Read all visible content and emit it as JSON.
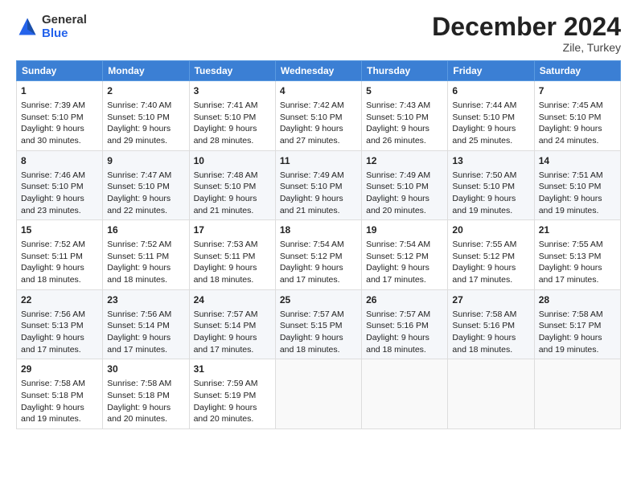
{
  "header": {
    "logo_line1": "General",
    "logo_line2": "Blue",
    "month_year": "December 2024",
    "location": "Zile, Turkey"
  },
  "weekdays": [
    "Sunday",
    "Monday",
    "Tuesday",
    "Wednesday",
    "Thursday",
    "Friday",
    "Saturday"
  ],
  "weeks": [
    [
      {
        "day": "1",
        "lines": [
          "Sunrise: 7:39 AM",
          "Sunset: 5:10 PM",
          "Daylight: 9 hours",
          "and 30 minutes."
        ]
      },
      {
        "day": "2",
        "lines": [
          "Sunrise: 7:40 AM",
          "Sunset: 5:10 PM",
          "Daylight: 9 hours",
          "and 29 minutes."
        ]
      },
      {
        "day": "3",
        "lines": [
          "Sunrise: 7:41 AM",
          "Sunset: 5:10 PM",
          "Daylight: 9 hours",
          "and 28 minutes."
        ]
      },
      {
        "day": "4",
        "lines": [
          "Sunrise: 7:42 AM",
          "Sunset: 5:10 PM",
          "Daylight: 9 hours",
          "and 27 minutes."
        ]
      },
      {
        "day": "5",
        "lines": [
          "Sunrise: 7:43 AM",
          "Sunset: 5:10 PM",
          "Daylight: 9 hours",
          "and 26 minutes."
        ]
      },
      {
        "day": "6",
        "lines": [
          "Sunrise: 7:44 AM",
          "Sunset: 5:10 PM",
          "Daylight: 9 hours",
          "and 25 minutes."
        ]
      },
      {
        "day": "7",
        "lines": [
          "Sunrise: 7:45 AM",
          "Sunset: 5:10 PM",
          "Daylight: 9 hours",
          "and 24 minutes."
        ]
      }
    ],
    [
      {
        "day": "8",
        "lines": [
          "Sunrise: 7:46 AM",
          "Sunset: 5:10 PM",
          "Daylight: 9 hours",
          "and 23 minutes."
        ]
      },
      {
        "day": "9",
        "lines": [
          "Sunrise: 7:47 AM",
          "Sunset: 5:10 PM",
          "Daylight: 9 hours",
          "and 22 minutes."
        ]
      },
      {
        "day": "10",
        "lines": [
          "Sunrise: 7:48 AM",
          "Sunset: 5:10 PM",
          "Daylight: 9 hours",
          "and 21 minutes."
        ]
      },
      {
        "day": "11",
        "lines": [
          "Sunrise: 7:49 AM",
          "Sunset: 5:10 PM",
          "Daylight: 9 hours",
          "and 21 minutes."
        ]
      },
      {
        "day": "12",
        "lines": [
          "Sunrise: 7:49 AM",
          "Sunset: 5:10 PM",
          "Daylight: 9 hours",
          "and 20 minutes."
        ]
      },
      {
        "day": "13",
        "lines": [
          "Sunrise: 7:50 AM",
          "Sunset: 5:10 PM",
          "Daylight: 9 hours",
          "and 19 minutes."
        ]
      },
      {
        "day": "14",
        "lines": [
          "Sunrise: 7:51 AM",
          "Sunset: 5:10 PM",
          "Daylight: 9 hours",
          "and 19 minutes."
        ]
      }
    ],
    [
      {
        "day": "15",
        "lines": [
          "Sunrise: 7:52 AM",
          "Sunset: 5:11 PM",
          "Daylight: 9 hours",
          "and 18 minutes."
        ]
      },
      {
        "day": "16",
        "lines": [
          "Sunrise: 7:52 AM",
          "Sunset: 5:11 PM",
          "Daylight: 9 hours",
          "and 18 minutes."
        ]
      },
      {
        "day": "17",
        "lines": [
          "Sunrise: 7:53 AM",
          "Sunset: 5:11 PM",
          "Daylight: 9 hours",
          "and 18 minutes."
        ]
      },
      {
        "day": "18",
        "lines": [
          "Sunrise: 7:54 AM",
          "Sunset: 5:12 PM",
          "Daylight: 9 hours",
          "and 17 minutes."
        ]
      },
      {
        "day": "19",
        "lines": [
          "Sunrise: 7:54 AM",
          "Sunset: 5:12 PM",
          "Daylight: 9 hours",
          "and 17 minutes."
        ]
      },
      {
        "day": "20",
        "lines": [
          "Sunrise: 7:55 AM",
          "Sunset: 5:12 PM",
          "Daylight: 9 hours",
          "and 17 minutes."
        ]
      },
      {
        "day": "21",
        "lines": [
          "Sunrise: 7:55 AM",
          "Sunset: 5:13 PM",
          "Daylight: 9 hours",
          "and 17 minutes."
        ]
      }
    ],
    [
      {
        "day": "22",
        "lines": [
          "Sunrise: 7:56 AM",
          "Sunset: 5:13 PM",
          "Daylight: 9 hours",
          "and 17 minutes."
        ]
      },
      {
        "day": "23",
        "lines": [
          "Sunrise: 7:56 AM",
          "Sunset: 5:14 PM",
          "Daylight: 9 hours",
          "and 17 minutes."
        ]
      },
      {
        "day": "24",
        "lines": [
          "Sunrise: 7:57 AM",
          "Sunset: 5:14 PM",
          "Daylight: 9 hours",
          "and 17 minutes."
        ]
      },
      {
        "day": "25",
        "lines": [
          "Sunrise: 7:57 AM",
          "Sunset: 5:15 PM",
          "Daylight: 9 hours",
          "and 18 minutes."
        ]
      },
      {
        "day": "26",
        "lines": [
          "Sunrise: 7:57 AM",
          "Sunset: 5:16 PM",
          "Daylight: 9 hours",
          "and 18 minutes."
        ]
      },
      {
        "day": "27",
        "lines": [
          "Sunrise: 7:58 AM",
          "Sunset: 5:16 PM",
          "Daylight: 9 hours",
          "and 18 minutes."
        ]
      },
      {
        "day": "28",
        "lines": [
          "Sunrise: 7:58 AM",
          "Sunset: 5:17 PM",
          "Daylight: 9 hours",
          "and 19 minutes."
        ]
      }
    ],
    [
      {
        "day": "29",
        "lines": [
          "Sunrise: 7:58 AM",
          "Sunset: 5:18 PM",
          "Daylight: 9 hours",
          "and 19 minutes."
        ]
      },
      {
        "day": "30",
        "lines": [
          "Sunrise: 7:58 AM",
          "Sunset: 5:18 PM",
          "Daylight: 9 hours",
          "and 20 minutes."
        ]
      },
      {
        "day": "31",
        "lines": [
          "Sunrise: 7:59 AM",
          "Sunset: 5:19 PM",
          "Daylight: 9 hours",
          "and 20 minutes."
        ]
      },
      null,
      null,
      null,
      null
    ]
  ]
}
